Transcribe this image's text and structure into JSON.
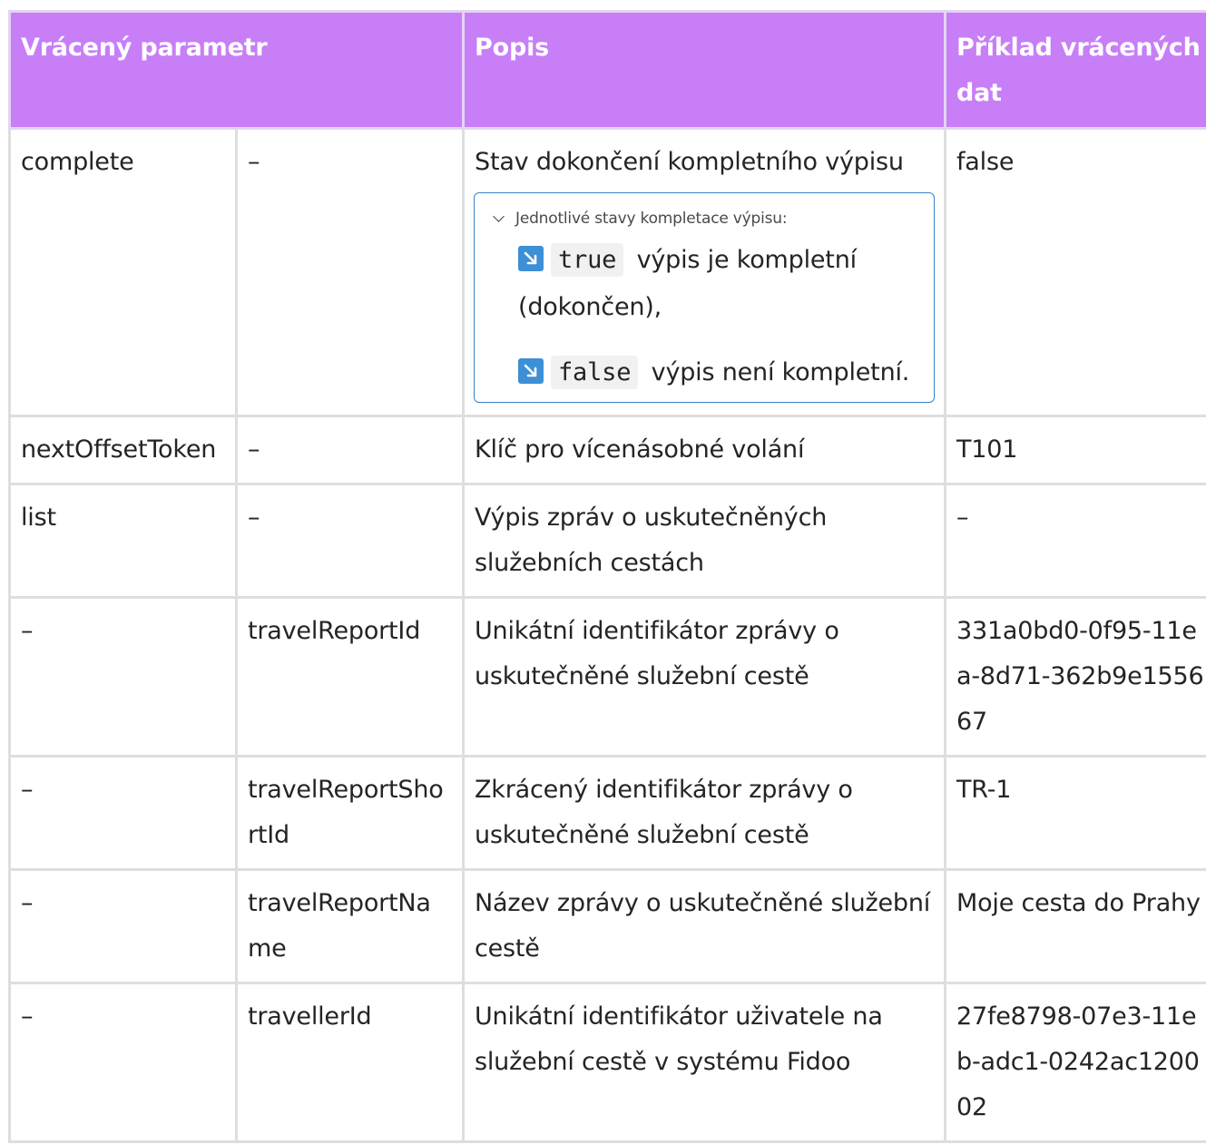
{
  "table": {
    "headers": {
      "parameter": "Vrácený parametr",
      "description": "Popis",
      "example": "Příklad vrácených dat"
    },
    "rows": [
      {
        "param": "complete",
        "sub": "–",
        "desc": "Stav dokončení kompletního výpisu",
        "example": "false"
      },
      {
        "param": "nextOffsetToken",
        "sub": "–",
        "desc": "Klíč pro vícenásobné volání",
        "example": "T101"
      },
      {
        "param": "list",
        "sub": "–",
        "desc": "Výpis zpráv o uskutečněných služebních cestách",
        "example": "–"
      },
      {
        "param": "–",
        "sub": "travelReportId",
        "desc": "Unikátní identifikátor zprávy o uskutečněné služební cestě",
        "example": "331a0bd0-0f95-11ea-8d71-362b9e155667"
      },
      {
        "param": "–",
        "sub": "travelReportShortId",
        "desc": "Zkrácený identifikátor zprávy o uskutečněné služební cestě",
        "example": "TR-1"
      },
      {
        "param": "–",
        "sub": "travelReportName",
        "desc": "Název zprávy o uskutečněné služební cestě",
        "example": "Moje cesta do Prahy"
      },
      {
        "param": "–",
        "sub": "travellerId",
        "desc": "Unikátní identifikátor uživatele na služební cestě v systému Fidoo",
        "example": "27fe8798-07e3-11eb-adc1-0242ac120002"
      }
    ]
  },
  "expander": {
    "title": "Jednotlivé stavy kompletace výpisu:",
    "states": [
      {
        "code": "true",
        "text": "výpis je kompletní (dokončen),"
      },
      {
        "code": "false",
        "text": "výpis není kompletní."
      }
    ]
  },
  "icons": {
    "expander": "chevron-down-icon",
    "state": "arrow-down-right-icon"
  },
  "colors": {
    "header_bg": "#c87ef7",
    "header_text": "#ffffff",
    "expander_border": "#3a83c9",
    "state_icon": "#3d8fd6"
  }
}
